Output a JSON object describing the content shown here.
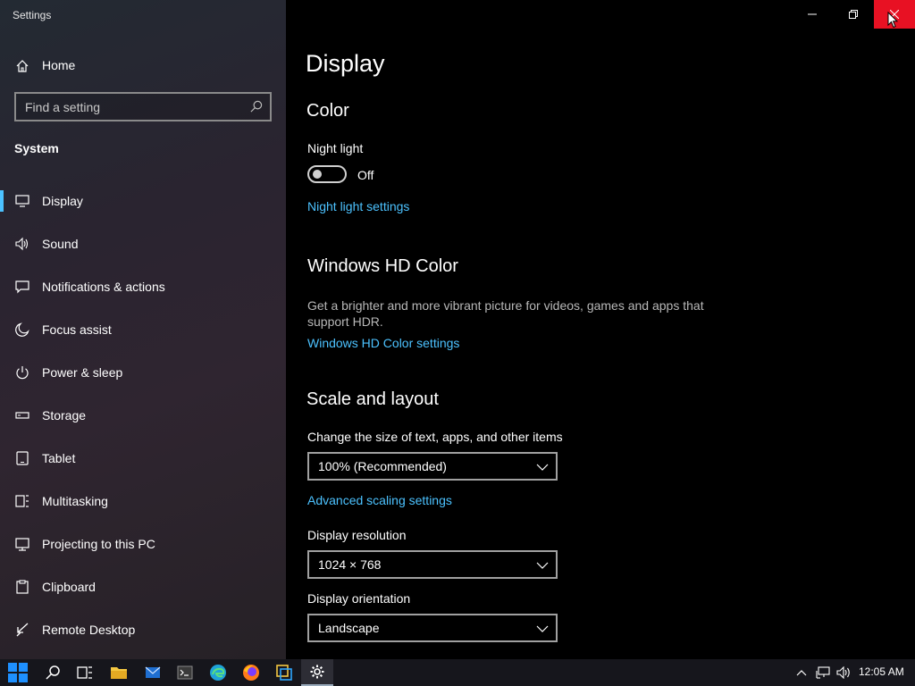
{
  "window": {
    "title": "Settings"
  },
  "sidebar": {
    "home_label": "Home",
    "search_placeholder": "Find a setting",
    "section": "System",
    "items": [
      {
        "label": "Display",
        "icon": "monitor-icon",
        "active": true
      },
      {
        "label": "Sound",
        "icon": "speaker-icon"
      },
      {
        "label": "Notifications & actions",
        "icon": "message-icon"
      },
      {
        "label": "Focus assist",
        "icon": "moon-icon"
      },
      {
        "label": "Power & sleep",
        "icon": "power-icon"
      },
      {
        "label": "Storage",
        "icon": "drive-icon"
      },
      {
        "label": "Tablet",
        "icon": "tablet-icon"
      },
      {
        "label": "Multitasking",
        "icon": "multitasking-icon"
      },
      {
        "label": "Projecting to this PC",
        "icon": "projector-icon"
      },
      {
        "label": "Clipboard",
        "icon": "clipboard-icon"
      },
      {
        "label": "Remote Desktop",
        "icon": "remote-desktop-icon"
      }
    ]
  },
  "main": {
    "title": "Display",
    "color": {
      "heading": "Color",
      "night_light_label": "Night light",
      "night_light_state": "Off",
      "night_light_link": "Night light settings"
    },
    "hd_color": {
      "heading": "Windows HD Color",
      "description": "Get a brighter and more vibrant picture for videos, games and apps that support HDR.",
      "link": "Windows HD Color settings"
    },
    "scale_layout": {
      "heading": "Scale and layout",
      "scale_label": "Change the size of text, apps, and other items",
      "scale_value": "100% (Recommended)",
      "advanced_link": "Advanced scaling settings",
      "resolution_label": "Display resolution",
      "resolution_value": "1024 × 768",
      "orientation_label": "Display orientation",
      "orientation_value": "Landscape"
    }
  },
  "taskbar": {
    "apps": [
      "start-icon",
      "search-icon",
      "task-view-icon",
      "file-explorer-icon",
      "mail-icon",
      "terminal-icon",
      "edge-icon",
      "firefox-icon",
      "app-icon",
      "settings-icon"
    ],
    "clock": "12:05 AM"
  },
  "colors": {
    "accent": "#4cc2ff",
    "close": "#e81123",
    "background": "#000000"
  }
}
